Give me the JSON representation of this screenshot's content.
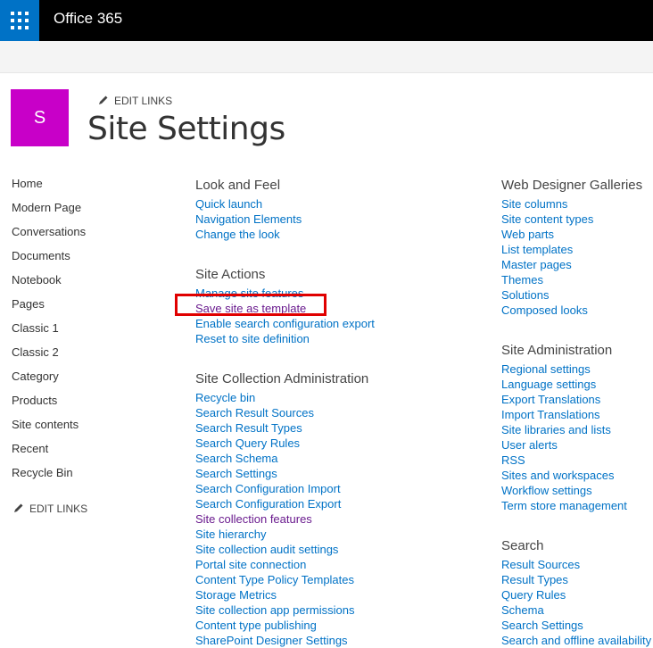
{
  "topbar": {
    "app_name": "Office 365"
  },
  "site": {
    "logo_letter": "S",
    "title": "Site Settings",
    "edit_links": "EDIT LINKS"
  },
  "quicklaunch": {
    "items": [
      "Home",
      "Modern Page",
      "Conversations",
      "Documents",
      "Notebook",
      "Pages",
      "Classic 1",
      "Classic 2",
      "Category",
      "Products",
      "Site contents",
      "Recent",
      "Recycle Bin"
    ],
    "edit_links": "EDIT LINKS"
  },
  "sections": {
    "look_and_feel": {
      "title": "Look and Feel",
      "links": [
        "Quick launch",
        "Navigation Elements",
        "Change the look"
      ]
    },
    "site_actions": {
      "title": "Site Actions",
      "links": [
        "Manage site features",
        "Save site as template",
        "Enable search configuration export",
        "Reset to site definition"
      ]
    },
    "site_collection_admin": {
      "title": "Site Collection Administration",
      "links": [
        "Recycle bin",
        "Search Result Sources",
        "Search Result Types",
        "Search Query Rules",
        "Search Schema",
        "Search Settings",
        "Search Configuration Import",
        "Search Configuration Export",
        "Site collection features",
        "Site hierarchy",
        "Site collection audit settings",
        "Portal site connection",
        "Content Type Policy Templates",
        "Storage Metrics",
        "Site collection app permissions",
        "Content type publishing",
        "SharePoint Designer Settings"
      ]
    },
    "web_designer_galleries": {
      "title": "Web Designer Galleries",
      "links": [
        "Site columns",
        "Site content types",
        "Web parts",
        "List templates",
        "Master pages",
        "Themes",
        "Solutions",
        "Composed looks"
      ]
    },
    "site_administration": {
      "title": "Site Administration",
      "links": [
        "Regional settings",
        "Language settings",
        "Export Translations",
        "Import Translations",
        "Site libraries and lists",
        "User alerts",
        "RSS",
        "Sites and workspaces",
        "Workflow settings",
        "Term store management"
      ]
    },
    "search": {
      "title": "Search",
      "links": [
        "Result Sources",
        "Result Types",
        "Query Rules",
        "Schema",
        "Search Settings",
        "Search and offline availability"
      ]
    }
  },
  "colors": {
    "link": "#0072c6",
    "visited": "#6a1b8e",
    "highlight": "#e00000",
    "logo_bg": "#c800c8",
    "waffle_bg": "#0072c6"
  }
}
